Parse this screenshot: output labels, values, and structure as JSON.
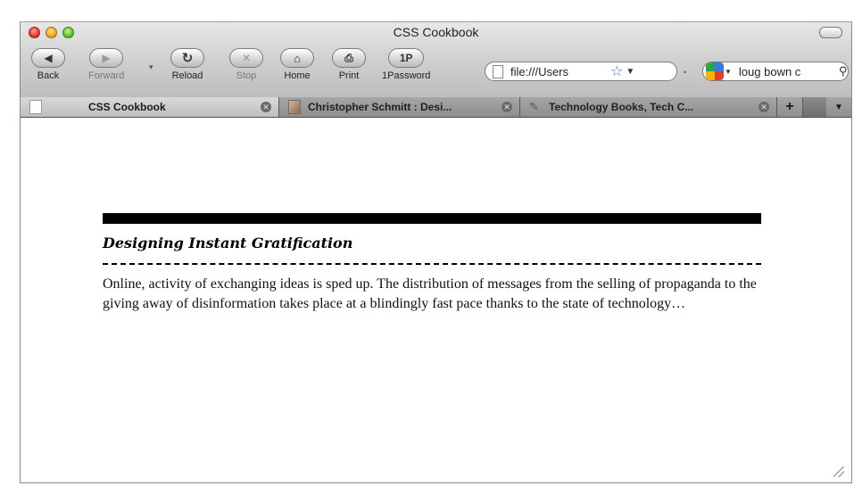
{
  "window": {
    "title": "CSS Cookbook"
  },
  "toolbar": {
    "back_label": "Back",
    "forward_label": "Forward",
    "reload_label": "Reload",
    "stop_label": "Stop",
    "home_label": "Home",
    "print_label": "Print",
    "onepassword_label": "1Password",
    "onepassword_glyph": "1P",
    "icons": [
      "back-icon",
      "forward-icon",
      "reload-icon",
      "stop-icon",
      "home-icon",
      "print-icon"
    ]
  },
  "address_bar": {
    "url": "file:///Users"
  },
  "search_bar": {
    "query": "loug bown c"
  },
  "tabs": [
    {
      "label": "CSS Cookbook",
      "active": true
    },
    {
      "label": "Christopher Schmitt : Desi...",
      "active": false
    },
    {
      "label": "Technology Books, Tech C...",
      "active": false
    }
  ],
  "page": {
    "heading": "Designing Instant Gratification",
    "body": "Online, activity of exchanging ideas is sped up. The distribution of messages from the selling of propaganda to the giving away of disinformation takes place at a blindingly fast pace thanks to the state of technology…"
  }
}
